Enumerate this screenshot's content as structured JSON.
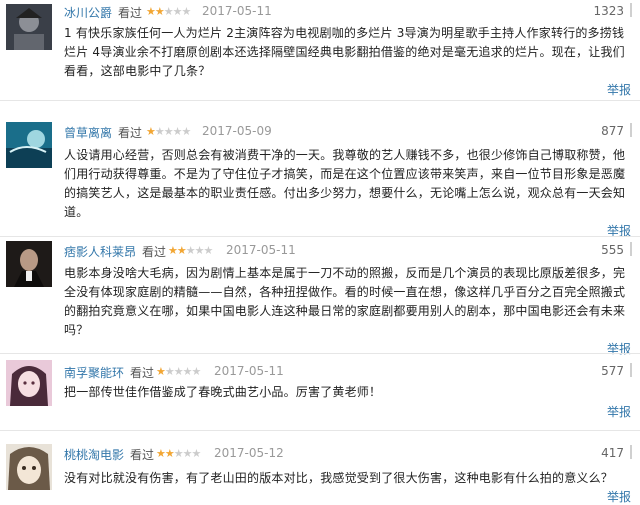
{
  "reviews": [
    {
      "user": "冰川公爵",
      "seen": "看过",
      "stars": 2,
      "date": "2017-05-11",
      "votes": "1323",
      "content": "1 有快乐家族任何一人为烂片 2主演阵容为电视剧咖的多烂片 3导演为明星歌手主持人作家转行的多捞钱烂片 4导演业余不打磨原创剧本还选择隔壁国经典电影翻拍借鉴的绝对是毫无追求的烂片。现在，让我们看看，这部电影中了几条？",
      "report": "举报",
      "avatar": "avatar-1"
    },
    {
      "user": "曾草离离",
      "seen": "看过",
      "stars": 1,
      "date": "2017-05-09",
      "votes": "877",
      "content": "人设请用心经营，否则总会有被消费干净的一天。我尊敬的艺人赚钱不多，也很少修饰自己博取称赞，他们用行动获得尊重。不是为了守住位子才搞笑，而是在这个位置应该带来笑声，来自一位节目形象是恶魔的搞笑艺人，这是最基本的职业责任感。付出多少努力，想要什么，无论嘴上怎么说，观众总有一天会知道。",
      "report": "举报",
      "avatar": "avatar-2"
    },
    {
      "user": "痞影人科莱昂",
      "seen": "看过",
      "stars": 2,
      "date": "2017-05-11",
      "votes": "555",
      "content": "电影本身没啥大毛病，因为剧情上基本是属于一刀不动的照搬，反而是几个演员的表现比原版差很多，完全没有体现家庭剧的精髓——自然，各种扭捏做作。看的时候一直在想，像这样几乎百分之百完全照搬式的翻拍究竟意义在哪，如果中国电影人连这种最日常的家庭剧都要用别人的剧本，那中国电影还会有未来吗？",
      "report": "举报",
      "avatar": "avatar-3"
    },
    {
      "user": "南孚聚能环",
      "seen": "看过",
      "stars": 1,
      "date": "2017-05-11",
      "votes": "577",
      "content": "把一部传世佳作借鉴成了春晚式曲艺小品。厉害了黄老师！",
      "report": "举报",
      "avatar": "avatar-4"
    },
    {
      "user": "桃桃淘电影",
      "seen": "看过",
      "stars": 2,
      "date": "2017-05-12",
      "votes": "417",
      "content": "没有对比就没有伤害，有了老山田的版本对比，我感觉受到了很大伤害，这种电影有什么拍的意义么？",
      "report": "举报",
      "avatar": "avatar-5"
    }
  ],
  "colors": {
    "link": "#3377aa",
    "star_on": "#f2a633",
    "star_off": "#cccccc",
    "date": "#999999"
  }
}
